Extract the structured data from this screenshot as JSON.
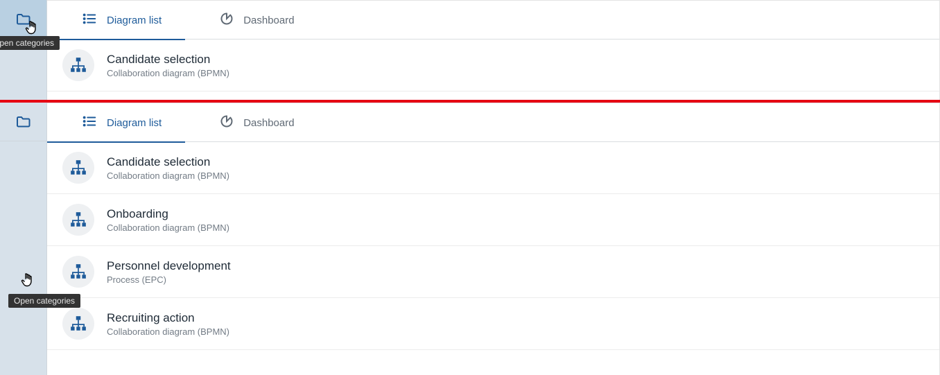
{
  "tooltip": "Open categories",
  "tabs": {
    "diagram_list": "Diagram list",
    "dashboard": "Dashboard"
  },
  "panel1_items": [
    {
      "title": "Candidate selection",
      "subtitle": "Collaboration diagram (BPMN)"
    }
  ],
  "panel2_items": [
    {
      "title": "Candidate selection",
      "subtitle": "Collaboration diagram (BPMN)"
    },
    {
      "title": "Onboarding",
      "subtitle": "Collaboration diagram (BPMN)"
    },
    {
      "title": "Personnel development",
      "subtitle": "Process (EPC)"
    },
    {
      "title": "Recruiting action",
      "subtitle": "Collaboration diagram (BPMN)"
    }
  ]
}
